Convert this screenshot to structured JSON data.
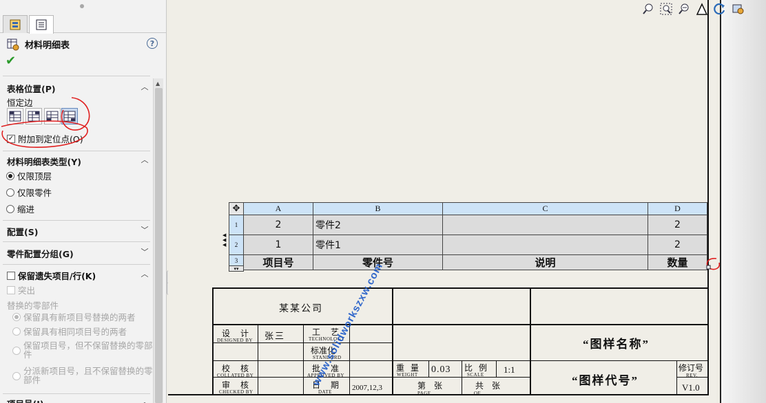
{
  "panel": {
    "title": "材料明细表",
    "help": "?",
    "ok": "✔",
    "sections": {
      "table_position": "表格位置(P)",
      "bom_type": "材料明细表类型(Y)",
      "configurations": "配置(S)",
      "part_config_grouping": "零件配置分组(G)",
      "keep_missing": "保留遗失项目/行(K)",
      "item_numbers": "项目号(I)"
    },
    "anchor_label": "恒定边",
    "attach_anchor": "附加到定位点(O)",
    "bom_types": [
      "仅限顶层",
      "仅限零件",
      "缩进"
    ],
    "strikeout": "突出",
    "replaced_label": "替换的零部件",
    "replace_options": [
      "保留具有新项目号替换的两者",
      "保留具有相同项目号的两者",
      "保留项目号，但不保留替换的零部件",
      "分派新项目号，且不保留替换的零部件"
    ]
  },
  "bom": {
    "columns": [
      "A",
      "B",
      "C",
      "D"
    ],
    "rows": [
      {
        "n": "1",
        "item": "2",
        "part": "零件2",
        "desc": "",
        "qty": "2"
      },
      {
        "n": "2",
        "item": "1",
        "part": "零件1",
        "desc": "",
        "qty": "2"
      },
      {
        "n": "3",
        "item": "项目号",
        "part": "零件号",
        "desc": "说明",
        "qty": "数量"
      }
    ]
  },
  "title_block": {
    "company": "某某公司",
    "design": "设 计",
    "design_en": "DESIGNED BY",
    "designer": "张三",
    "tech": "工 艺",
    "tech_en": "TECHNOLOGY",
    "standard": "标准化",
    "standard_en": "STANDARD",
    "collate": "校 核",
    "collate_en": "COLLATED BY",
    "approve": "批 准",
    "approve_en": "APPROVED BY",
    "check": "审 核",
    "check_en": "CHECKED BY",
    "date": "日 期",
    "date_en": "DATE",
    "date_value": "2007,12,3",
    "weight": "重 量",
    "weight_en": "WEIGHT",
    "weight_value": "0.03",
    "scale": "比 例",
    "scale_en": "SCALE",
    "scale_value": "1:1",
    "page": "第  张",
    "page_en": "PAGE",
    "of": "共  张",
    "of_en": "OF",
    "drawing_name": "“图样名称”",
    "drawing_code": "“图样代号”",
    "rev": "修订号",
    "rev_en": "REV.",
    "rev_value": "V1.0"
  },
  "watermark": "www.solidworkszxw.com",
  "icons": [
    "zoom-to-fit-icon",
    "zoom-area-icon",
    "zoom-in-out-icon",
    "pan-icon",
    "rotate-icon",
    "view-settings-icon"
  ]
}
